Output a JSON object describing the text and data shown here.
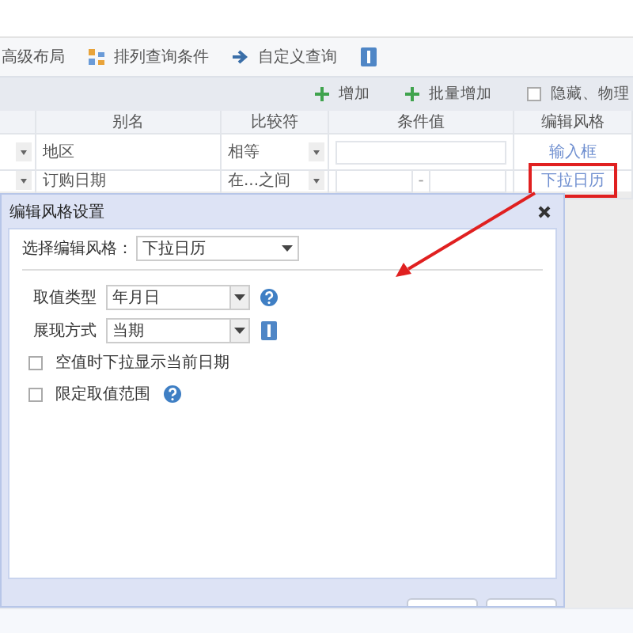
{
  "toolbar": [
    {
      "kind": "text",
      "label": "高级布局"
    },
    {
      "kind": "sort",
      "label": "排列查询条件"
    },
    {
      "kind": "custom",
      "label": "自定义查询"
    },
    {
      "kind": "info"
    }
  ],
  "actions": [
    {
      "label": "增加"
    },
    {
      "label": "批量增加"
    }
  ],
  "hide_checkbox": {
    "label": "隐藏、物理",
    "checked": false
  },
  "table": {
    "columns": [
      "别名",
      "比较符",
      "条件值",
      "编辑风格"
    ],
    "rows": [
      {
        "alias": "地区",
        "operator": "相等",
        "style": "输入框",
        "highlighted": false
      },
      {
        "alias": "订购日期",
        "operator": "在...之间",
        "separator": "-",
        "style": "下拉日历",
        "highlighted": true
      }
    ]
  },
  "dialog": {
    "title": "编辑风格设置",
    "style_select": {
      "label": "选择编辑风格：",
      "value": "下拉日历"
    },
    "fields": [
      {
        "label": "取值类型",
        "value": "年月日"
      },
      {
        "label": "展现方式",
        "value": "当期"
      }
    ],
    "checkboxes": [
      {
        "label": "空值时下拉显示当前日期",
        "checked": false,
        "help": false
      },
      {
        "label": "限定取值范围",
        "checked": false,
        "help": true
      }
    ]
  }
}
